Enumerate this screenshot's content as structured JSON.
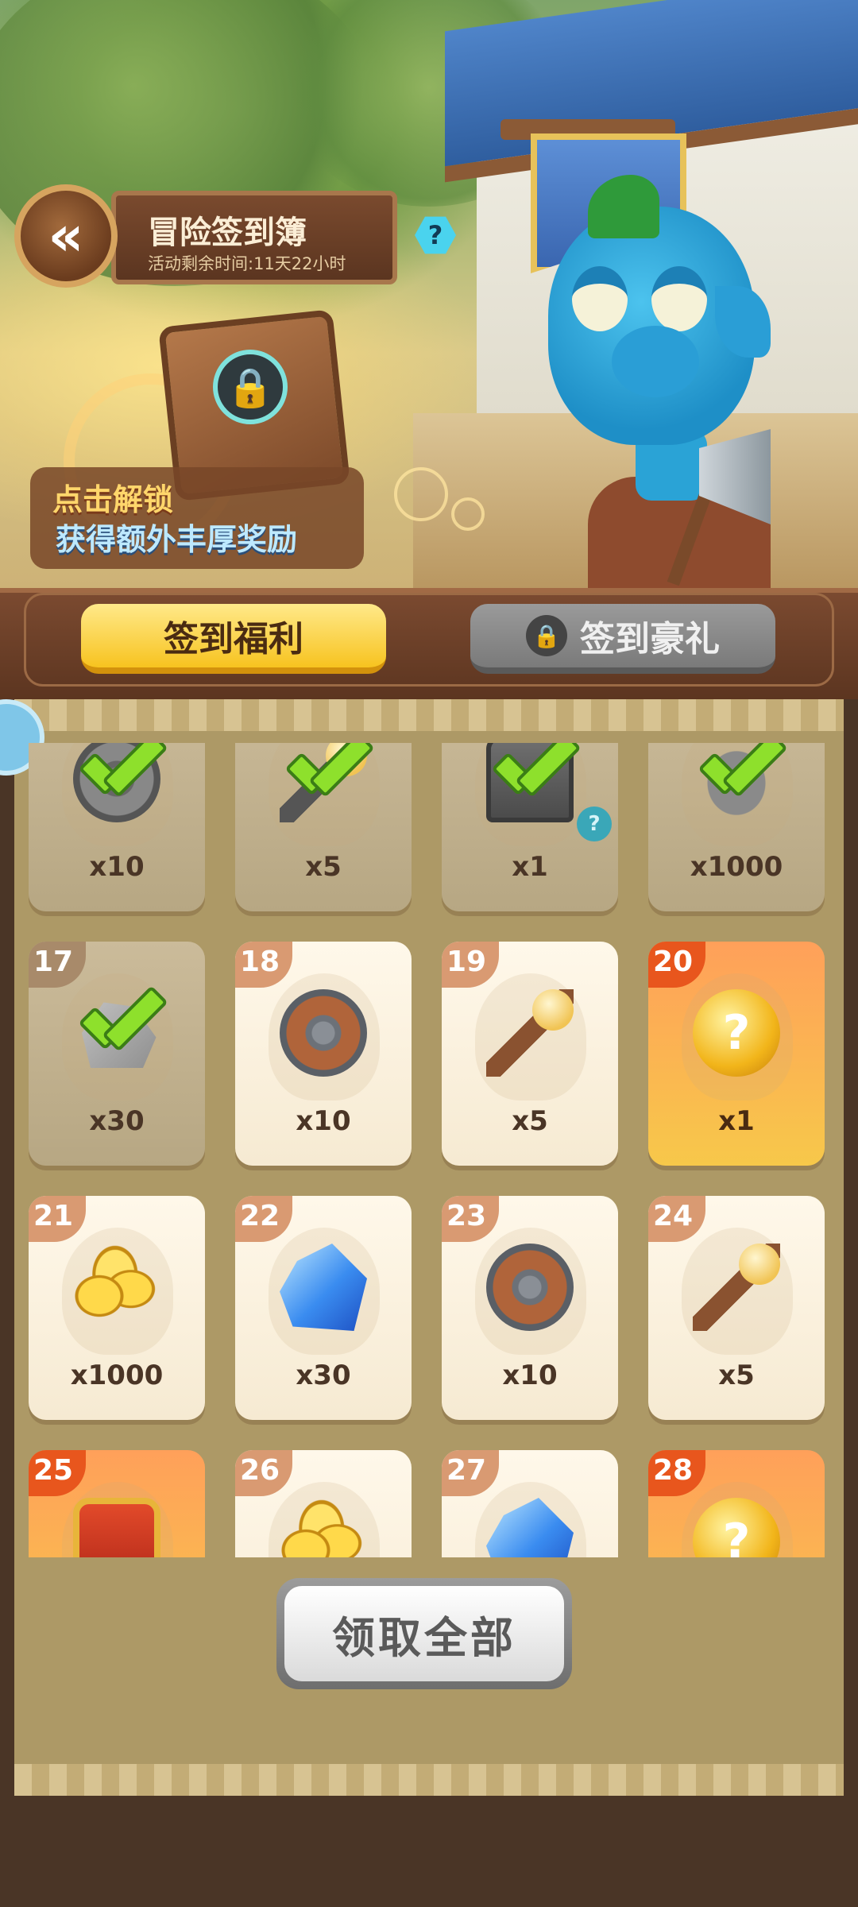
{
  "header": {
    "title": "冒险签到簿",
    "subtitle": "活动剩余时间:11天22小时",
    "help_icon": "?"
  },
  "book_promo": {
    "line1": "点击解锁",
    "line2": "获得额外丰厚奖励"
  },
  "tabs": [
    {
      "label": "签到福利",
      "active": true,
      "locked": false
    },
    {
      "label": "签到豪礼",
      "active": false,
      "locked": true
    }
  ],
  "grid": [
    {
      "day": "",
      "qty": "x10",
      "item": "shield",
      "state": "claimed"
    },
    {
      "day": "",
      "qty": "x5",
      "item": "staff",
      "state": "claimed"
    },
    {
      "day": "",
      "qty": "x1",
      "item": "chest",
      "state": "claimed",
      "info": "?"
    },
    {
      "day": "",
      "qty": "x1000",
      "item": "coins",
      "state": "claimed"
    },
    {
      "day": "17",
      "qty": "x30",
      "item": "ore",
      "state": "claimed"
    },
    {
      "day": "18",
      "qty": "x10",
      "item": "shield",
      "state": "open"
    },
    {
      "day": "19",
      "qty": "x5",
      "item": "staff",
      "state": "open"
    },
    {
      "day": "20",
      "qty": "x1",
      "item": "mystery",
      "state": "special"
    },
    {
      "day": "21",
      "qty": "x1000",
      "item": "coins",
      "state": "open"
    },
    {
      "day": "22",
      "qty": "x30",
      "item": "gem",
      "state": "open"
    },
    {
      "day": "23",
      "qty": "x10",
      "item": "shield",
      "state": "open"
    },
    {
      "day": "24",
      "qty": "x5",
      "item": "staff",
      "state": "open"
    },
    {
      "day": "25",
      "qty": "",
      "item": "treasure",
      "state": "special"
    },
    {
      "day": "26",
      "qty": "",
      "item": "coins",
      "state": "open"
    },
    {
      "day": "27",
      "qty": "",
      "item": "gem",
      "state": "open"
    },
    {
      "day": "28",
      "qty": "",
      "item": "mystery",
      "state": "special"
    }
  ],
  "claim_all": "领取全部",
  "back_icon": "«"
}
